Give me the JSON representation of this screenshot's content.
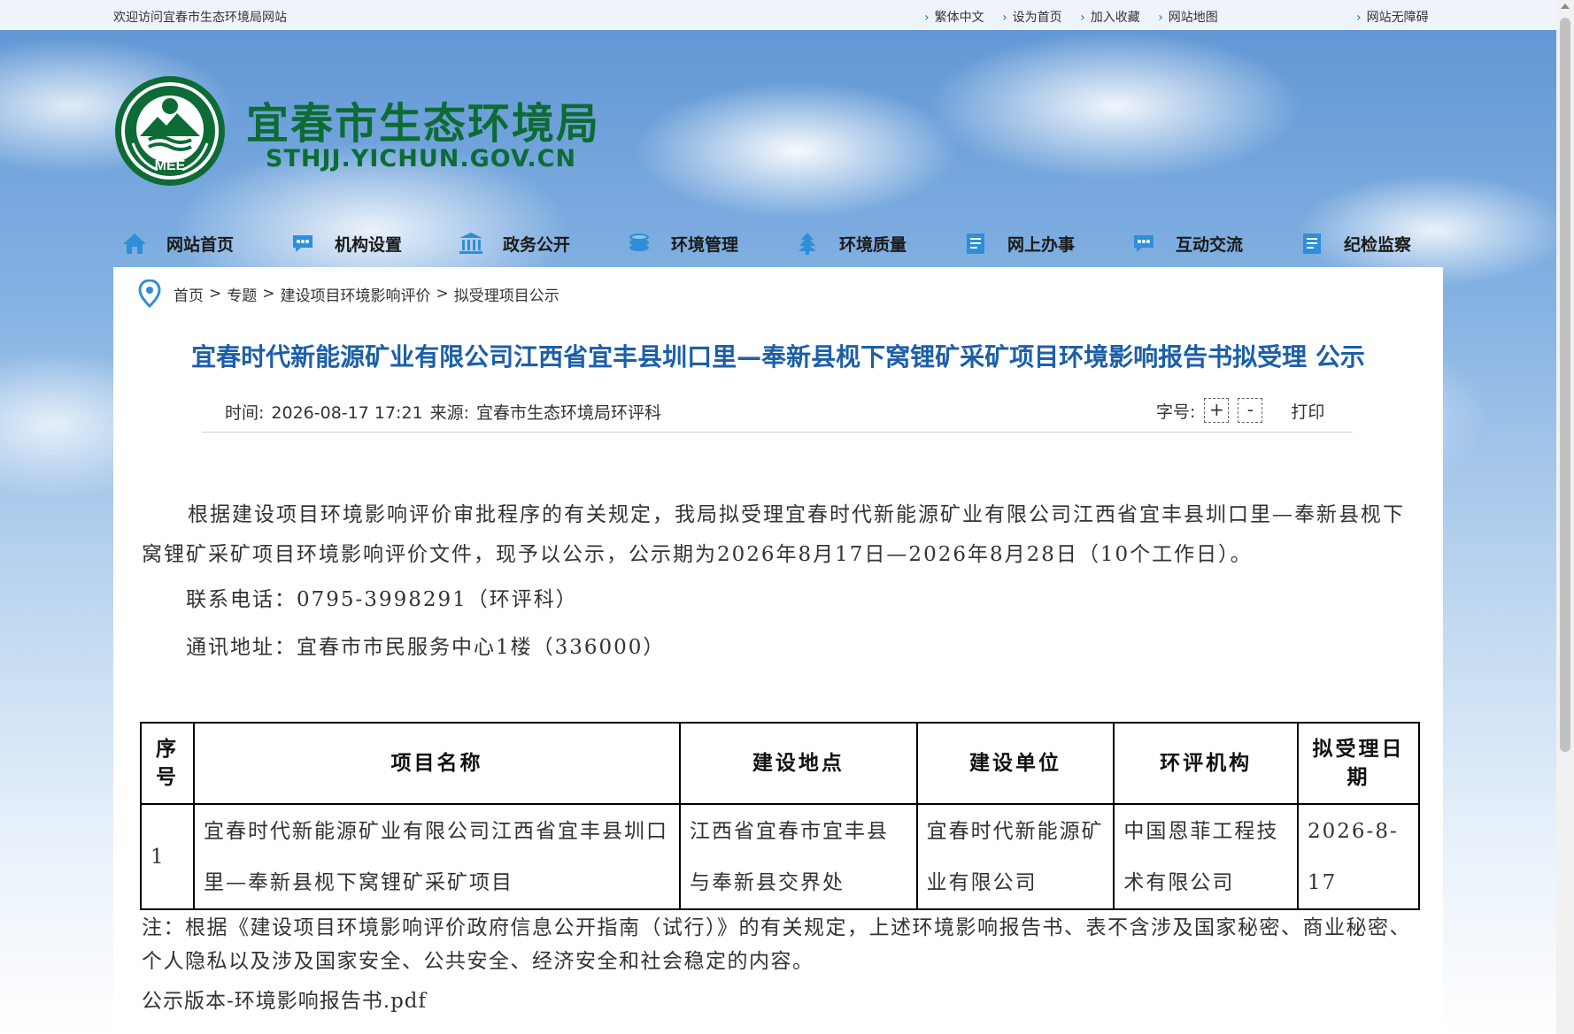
{
  "topbar": {
    "welcome": "欢迎访问宜春市生态环境局网站",
    "links": [
      "繁体中文",
      "设为首页",
      "加入收藏",
      "网站地图"
    ],
    "accessibility": "网站无障碍"
  },
  "header": {
    "logo_text": "MEE",
    "site_title": "宜春市生态环境局",
    "site_url": "STHJJ.YICHUN.GOV.CN"
  },
  "nav": {
    "items": [
      {
        "label": "网站首页",
        "icon": "home-icon"
      },
      {
        "label": "机构设置",
        "icon": "chat-bubble-icon"
      },
      {
        "label": "政务公开",
        "icon": "government-building-icon"
      },
      {
        "label": "环境管理",
        "icon": "coins-stack-icon"
      },
      {
        "label": "环境质量",
        "icon": "tree-icon"
      },
      {
        "label": "网上办事",
        "icon": "document-icon"
      },
      {
        "label": "互动交流",
        "icon": "chat-bubble-icon"
      },
      {
        "label": "纪检监察",
        "icon": "document-icon"
      }
    ]
  },
  "breadcrumb": {
    "items": [
      "首页",
      "专题",
      "建设项目环境影响评价",
      "拟受理项目公示"
    ],
    "separator": ">"
  },
  "article": {
    "title": "宜春时代新能源矿业有限公司江西省宜丰县圳口里—奉新县枧下窝锂矿采矿项目环境影响报告书拟受理 公示",
    "time_label": "时间:",
    "time_value": "2026-08-17 17:21",
    "source_label": "来源:",
    "source_value": "宜春市生态环境局环评科",
    "font_size_label": "字号:",
    "font_plus": "+",
    "font_minus": "-",
    "print_label": "打印",
    "paragraph1": "根据建设项目环境影响评价审批程序的有关规定，我局拟受理宜春时代新能源矿业有限公司江西省宜丰县圳口里—奉新县枧下窝锂矿采矿项目环境影响评价文件，现予以公示，公示期为2026年8月17日—2026年8月28日（10个工作日）。",
    "phone": "联系电话：0795-3998291（环评科）",
    "address": "通讯地址：宜春市市民服务中心1楼（336000）"
  },
  "table": {
    "headers": [
      "序号",
      "项目名称",
      "建设地点",
      "建设单位",
      "环评机构",
      "拟受理日期"
    ],
    "rows": [
      [
        "1",
        "宜春时代新能源矿业有限公司江西省宜丰县圳口里—奉新县枧下窝锂矿采矿项目",
        "江西省宜春市宜丰县与奉新县交界处",
        "宜春时代新能源矿业有限公司",
        "中国恩菲工程技术有限公司",
        "2026-8-17"
      ]
    ]
  },
  "note": "注：根据《建设项目环境影响评价政府信息公开指南（试行）》的有关规定，上述环境影响报告书、表不含涉及国家秘密、商业秘密、个人隐私以及涉及国家安全、公共安全、经济安全和社会稳定的内容。",
  "attachment": "公示版本-环境影响报告书.pdf",
  "colors": {
    "brand_green": "#0d6b35",
    "title_blue": "#1c5fa8",
    "nav_icon_blue": "#2e8fd8"
  }
}
